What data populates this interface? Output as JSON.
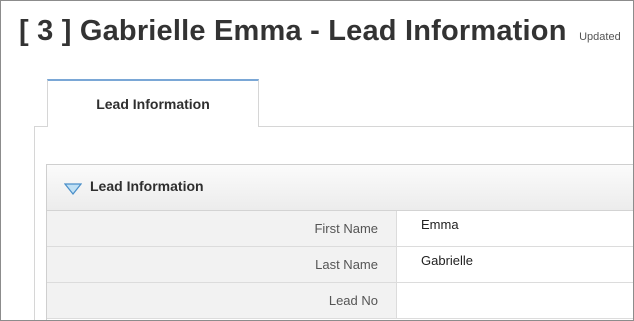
{
  "header": {
    "title": "[ 3 ] Gabrielle Emma - Lead Information",
    "updated_text": "Updated"
  },
  "tabs": [
    {
      "label": "Lead Information",
      "active": true
    }
  ],
  "block": {
    "title": "Lead Information",
    "icon": "collapse-triangle-icon",
    "fields": [
      {
        "label": "First Name",
        "value": "Emma"
      },
      {
        "label": "Last Name",
        "value": "Gabrielle"
      },
      {
        "label": "Lead No",
        "value": ""
      }
    ]
  },
  "colors": {
    "accent": "#7aa7d6",
    "label_bg": "#f2f2f2",
    "border": "#d6d6d6"
  }
}
